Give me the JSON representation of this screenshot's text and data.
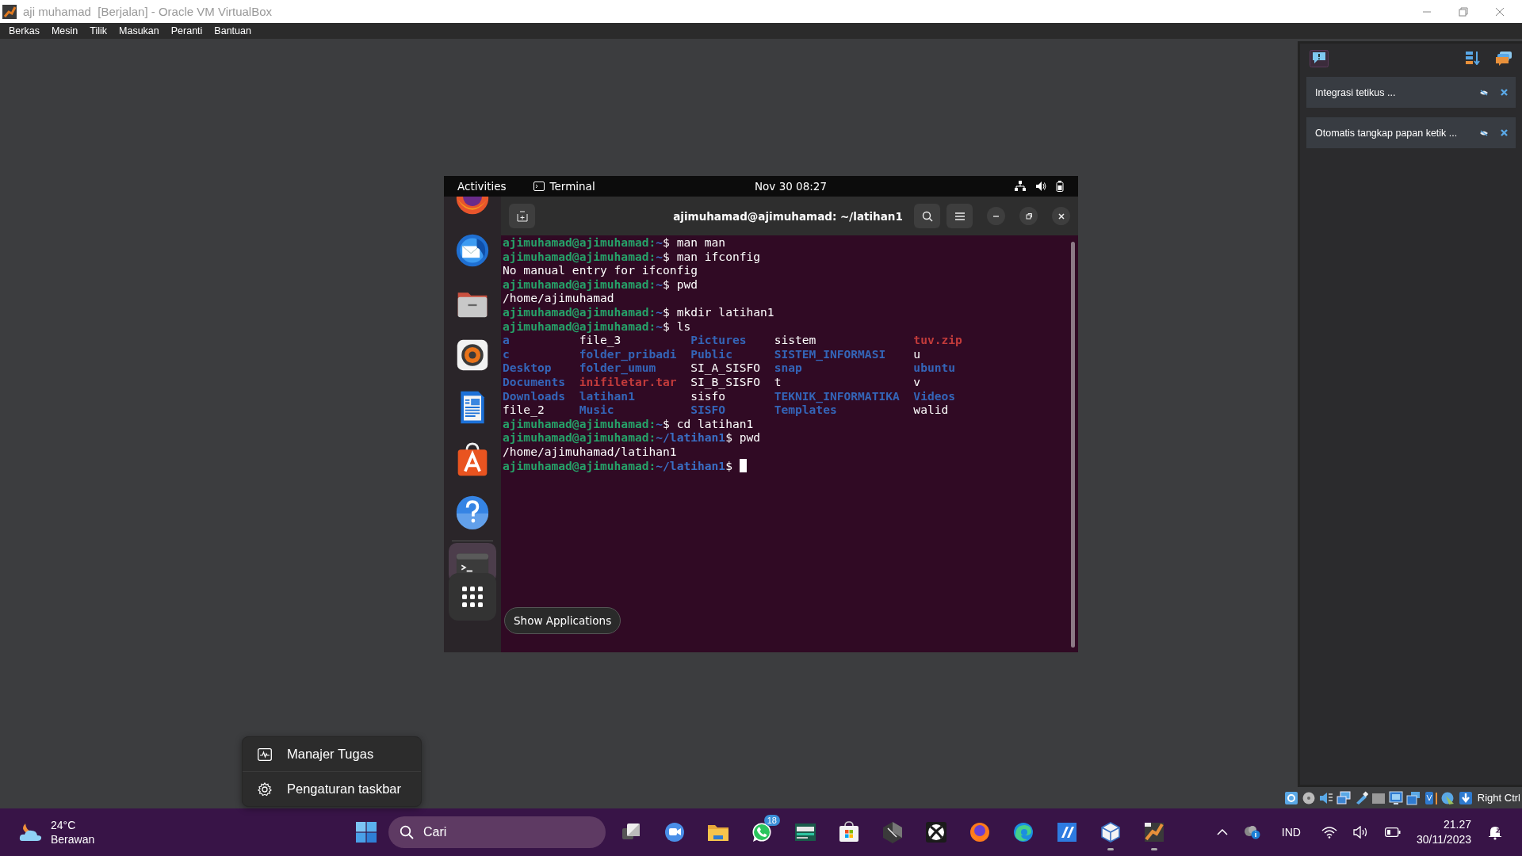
{
  "window": {
    "title": "aji muhamad  [Berjalan] - Oracle VM VirtualBox"
  },
  "menu": [
    "Berkas",
    "Mesin",
    "Tilik",
    "Masukan",
    "Peranti",
    "Bantuan"
  ],
  "notification_center": {
    "items": [
      {
        "text": "Integrasi tetikus ..."
      },
      {
        "text": "Otomatis tangkap papan ketik ..."
      }
    ]
  },
  "guest": {
    "top_bar": {
      "activities": "Activities",
      "app": "Terminal",
      "clock": "Nov 30  08:27"
    },
    "dock": {
      "items": [
        {
          "active": false
        },
        {
          "active": false
        },
        {
          "active": false
        },
        {
          "active": false
        },
        {
          "active": false
        },
        {
          "active": false
        },
        {
          "active": false
        },
        {
          "active": true
        }
      ],
      "tooltip": "Show Applications"
    },
    "terminal": {
      "title": "ajimuhamad@ajimuhamad: ~/latihan1",
      "lines": [
        {
          "kind": "prompt",
          "user": "ajimuhamad@ajimuhamad:",
          "path": "~",
          "symbol": "$",
          "command": "man man"
        },
        {
          "kind": "prompt",
          "user": "ajimuhamad@ajimuhamad:",
          "path": "~",
          "symbol": "$",
          "command": "man ifconfig"
        },
        {
          "kind": "output",
          "text": "No manual entry for ifconfig"
        },
        {
          "kind": "prompt",
          "user": "ajimuhamad@ajimuhamad:",
          "path": "~",
          "symbol": "$",
          "command": "pwd"
        },
        {
          "kind": "output",
          "text": "/home/ajimuhamad"
        },
        {
          "kind": "prompt",
          "user": "ajimuhamad@ajimuhamad:",
          "path": "~",
          "symbol": "$",
          "command": "mkdir latihan1"
        },
        {
          "kind": "prompt",
          "user": "ajimuhamad@ajimuhamad:",
          "path": "~",
          "symbol": "$",
          "command": "ls"
        },
        {
          "kind": "ls",
          "rows": [
            [
              {
                "text": "a",
                "kind": "dir"
              },
              {
                "text": "file_3",
                "kind": "file"
              },
              {
                "text": "Pictures",
                "kind": "dir"
              },
              {
                "text": "sistem",
                "kind": "file"
              },
              {
                "text": "tuv.zip",
                "kind": "archive"
              }
            ],
            [
              {
                "text": "c",
                "kind": "dir"
              },
              {
                "text": "folder_pribadi",
                "kind": "dir"
              },
              {
                "text": "Public",
                "kind": "dir"
              },
              {
                "text": "SISTEM_INFORMASI",
                "kind": "dir"
              },
              {
                "text": "u",
                "kind": "file"
              }
            ],
            [
              {
                "text": "Desktop",
                "kind": "dir"
              },
              {
                "text": "folder_umum",
                "kind": "dir"
              },
              {
                "text": "SI_A_SISFO",
                "kind": "file"
              },
              {
                "text": "snap",
                "kind": "dir"
              },
              {
                "text": "ubuntu",
                "kind": "dir"
              }
            ],
            [
              {
                "text": "Documents",
                "kind": "dir"
              },
              {
                "text": "inifiletar.tar",
                "kind": "archive"
              },
              {
                "text": "SI_B_SISFO",
                "kind": "file"
              },
              {
                "text": "t",
                "kind": "file"
              },
              {
                "text": "v",
                "kind": "file"
              }
            ],
            [
              {
                "text": "Downloads",
                "kind": "dir"
              },
              {
                "text": "latihan1",
                "kind": "dir"
              },
              {
                "text": "sisfo",
                "kind": "file"
              },
              {
                "text": "TEKNIK_INFORMATIKA",
                "kind": "dir"
              },
              {
                "text": "Videos",
                "kind": "dir"
              }
            ],
            [
              {
                "text": "file_2",
                "kind": "file"
              },
              {
                "text": "Music",
                "kind": "dir"
              },
              {
                "text": "SISFO",
                "kind": "dir"
              },
              {
                "text": "Templates",
                "kind": "dir"
              },
              {
                "text": "walid",
                "kind": "file"
              }
            ]
          ]
        },
        {
          "kind": "prompt",
          "user": "ajimuhamad@ajimuhamad:",
          "path": "~",
          "symbol": "$",
          "command": "cd latihan1"
        },
        {
          "kind": "prompt",
          "user": "ajimuhamad@ajimuhamad:",
          "path": "~/latihan1",
          "symbol": "$",
          "command": "pwd"
        },
        {
          "kind": "output",
          "text": "/home/ajimuhamad/latihan1"
        },
        {
          "kind": "prompt",
          "user": "ajimuhamad@ajimuhamad:",
          "path": "~/latihan1",
          "symbol": "$",
          "cursor": true
        }
      ]
    }
  },
  "status_bar": {
    "host_key": "Right Ctrl"
  },
  "context_menu": {
    "items": [
      {
        "label": "Manajer Tugas",
        "kind": "task-manager"
      },
      {
        "label": "Pengaturan taskbar",
        "kind": "settings"
      }
    ]
  },
  "taskbar": {
    "weather": {
      "temperature": "24°C",
      "condition": "Berawan"
    },
    "search": {
      "placeholder": "Cari"
    },
    "apps": [
      {
        "running": false
      },
      {
        "running": false
      },
      {
        "running": false
      },
      {
        "running": false,
        "badge": "18"
      },
      {
        "running": false
      },
      {
        "running": false
      },
      {
        "running": false
      },
      {
        "running": false
      },
      {
        "running": false
      },
      {
        "running": false
      },
      {
        "running": false
      },
      {
        "running": true
      },
      {
        "running": true
      }
    ],
    "tray": {
      "language": "IND",
      "time": "21.27",
      "date": "30/11/2023"
    }
  }
}
